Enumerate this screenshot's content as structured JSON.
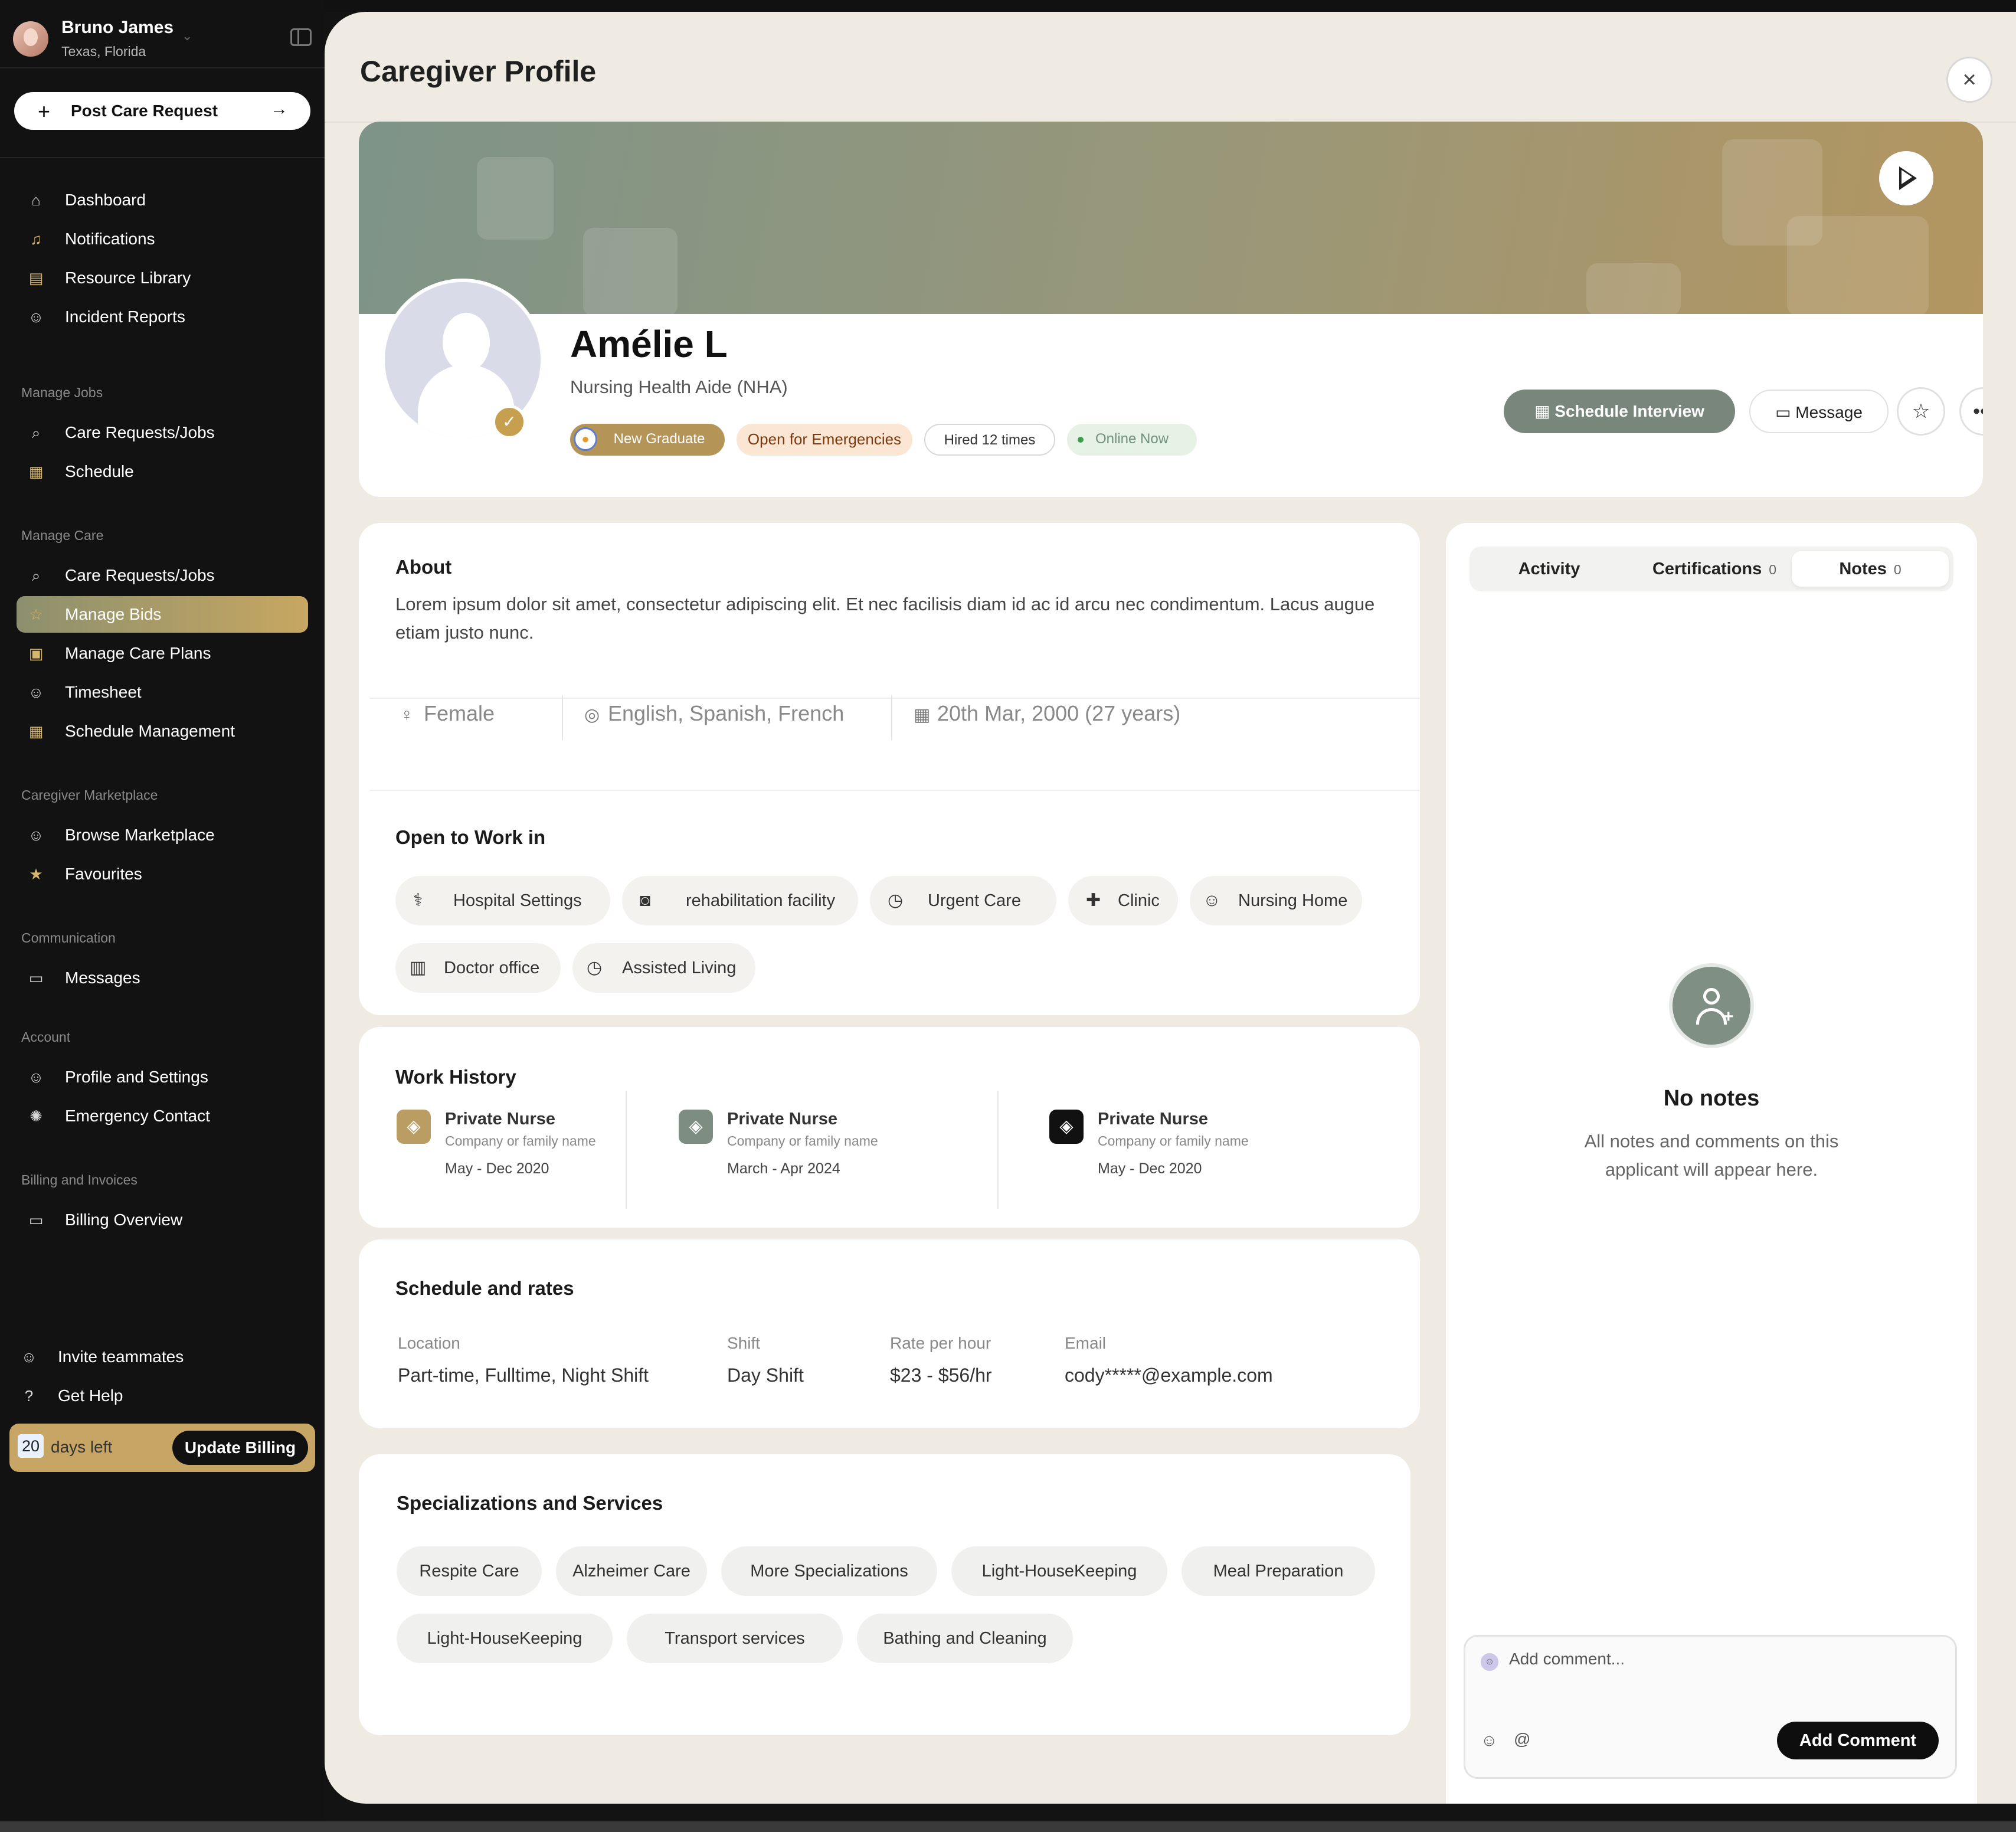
{
  "user": {
    "name": "Bruno James",
    "location": "Texas, Florida"
  },
  "sidebar": {
    "post_label": "Post Care Request",
    "main_items": [
      {
        "label": "Dashboard"
      },
      {
        "label": "Notifications"
      },
      {
        "label": "Resource Library"
      },
      {
        "label": "Incident Reports"
      }
    ],
    "sections": [
      {
        "title": "Manage Jobs",
        "items": [
          {
            "label": "Care Requests/Jobs"
          },
          {
            "label": "Schedule"
          }
        ]
      },
      {
        "title": "Manage Care",
        "items": [
          {
            "label": "Care Requests/Jobs"
          },
          {
            "label": "Manage Bids",
            "active": true
          },
          {
            "label": "Manage Care Plans"
          },
          {
            "label": "Timesheet"
          },
          {
            "label": "Schedule Management"
          }
        ]
      },
      {
        "title": "Caregiver Marketplace",
        "items": [
          {
            "label": "Browse Marketplace"
          },
          {
            "label": "Favourites"
          }
        ]
      },
      {
        "title": "Communication",
        "items": [
          {
            "label": "Messages"
          }
        ]
      },
      {
        "title": "Account",
        "items": [
          {
            "label": "Profile and Settings"
          },
          {
            "label": "Emergency Contact"
          }
        ]
      },
      {
        "title": "Billing and Invoices",
        "items": [
          {
            "label": "Billing Overview"
          }
        ]
      }
    ],
    "footer_items": [
      {
        "label": "Invite teammates"
      },
      {
        "label": "Get Help"
      }
    ],
    "billing": {
      "days": "20",
      "days_label": "days left",
      "button": "Update Billing"
    }
  },
  "page": {
    "title": "Caregiver Profile"
  },
  "profile": {
    "name": "Amélie L",
    "role": "Nursing Health Aide (NHA)",
    "tags": {
      "new_graduate": "New Graduate",
      "emergencies": "Open for Emergencies",
      "hired": "Hired 12 times",
      "online": "Online Now"
    },
    "actions": {
      "schedule": "Schedule Interview",
      "message": "Message"
    }
  },
  "about": {
    "title": "About",
    "text": "Lorem ipsum dolor sit amet, consectetur adipiscing elit. Et nec facilisis diam id ac id arcu nec condimentum. Lacus augue etiam justo nunc.",
    "gender": "Female",
    "languages": "English, Spanish, French",
    "dob": "20th Mar, 2000 (27 years)",
    "open_title": "Open to Work in",
    "work_places": [
      "Hospital Settings",
      "rehabilitation facility",
      "Urgent Care",
      "Clinic",
      "Nursing Home",
      "Doctor office",
      "Assisted Living"
    ]
  },
  "work_history": {
    "title": "Work History",
    "items": [
      {
        "role": "Private Nurse",
        "company": "Company or family name",
        "dates": "May - Dec 2020",
        "color": "#b99d63"
      },
      {
        "role": "Private Nurse",
        "company": "Company or family name",
        "dates": "March - Apr 2024",
        "color": "#7e8d82"
      },
      {
        "role": "Private Nurse",
        "company": "Company or family name",
        "dates": "May - Dec 2020",
        "color": "#111111"
      }
    ]
  },
  "schedule": {
    "title": "Schedule and rates",
    "fields": [
      {
        "label": "Location",
        "value": "Part-time, Fulltime, Night Shift"
      },
      {
        "label": "Shift",
        "value": "Day Shift"
      },
      {
        "label": "Rate per hour",
        "value": "$23 - $56/hr"
      },
      {
        "label": "Email",
        "value": "cody*****@example.com"
      }
    ]
  },
  "specializations": {
    "title": "Specializations and Services",
    "items": [
      "Respite Care",
      "Alzheimer Care",
      "More Specializations",
      "Light-HouseKeeping",
      "Meal Preparation",
      "Light-HouseKeeping",
      "Transport services",
      "Bathing and Cleaning"
    ]
  },
  "notes_panel": {
    "tabs": [
      {
        "label": "Activity",
        "count": ""
      },
      {
        "label": "Certifications",
        "count": "0"
      },
      {
        "label": "Notes",
        "count": "0"
      }
    ],
    "empty_title": "No notes",
    "empty_desc": "All notes and comments on this applicant will appear here.",
    "comment_placeholder": "Add comment...",
    "add_button": "Add Comment"
  },
  "colors": {
    "accent_gold": "#c7a565",
    "accent_sage": "#78867c",
    "sidebar_bg": "#121212",
    "page_bg": "#efebe2"
  }
}
